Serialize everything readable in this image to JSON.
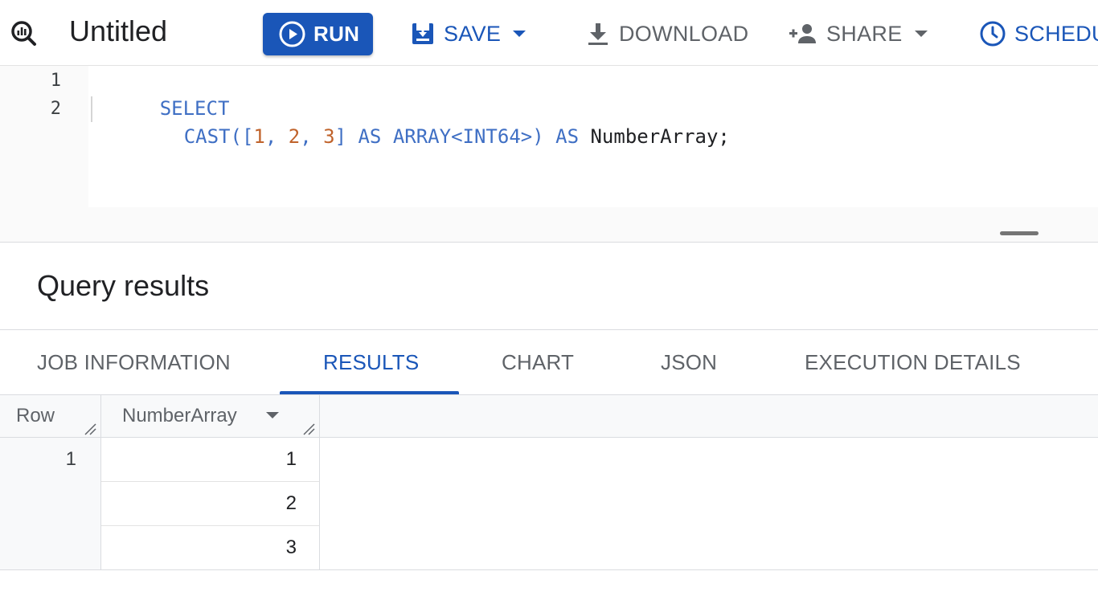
{
  "toolbar": {
    "title": "Untitled",
    "run_label": "RUN",
    "save_label": "SAVE",
    "download_label": "DOWNLOAD",
    "share_label": "SHARE",
    "schedule_label": "SCHEDU",
    "colors": {
      "primary": "#1a56b8",
      "muted": "#5f6368"
    }
  },
  "editor": {
    "lines": [
      {
        "number": "1",
        "tokens": [
          {
            "text": "SELECT",
            "kind": "kw"
          }
        ]
      },
      {
        "number": "2",
        "tokens": [
          {
            "text": "CAST([",
            "kind": "kw"
          },
          {
            "text": "1",
            "kind": "num"
          },
          {
            "text": ", ",
            "kind": "kw"
          },
          {
            "text": "2",
            "kind": "num"
          },
          {
            "text": ", ",
            "kind": "kw"
          },
          {
            "text": "3",
            "kind": "num"
          },
          {
            "text": "] AS ARRAY<INT64>) AS ",
            "kind": "kw"
          },
          {
            "text": "NumberArray",
            "kind": "ident"
          },
          {
            "text": ";",
            "kind": "ident"
          }
        ]
      }
    ]
  },
  "results": {
    "title": "Query results",
    "tabs": [
      "JOB INFORMATION",
      "RESULTS",
      "CHART",
      "JSON",
      "EXECUTION DETAILS"
    ],
    "active_tab": "RESULTS",
    "columns": [
      "Row",
      "NumberArray"
    ],
    "rows": [
      {
        "row": "1",
        "values": [
          "1",
          "2",
          "3"
        ]
      }
    ]
  }
}
